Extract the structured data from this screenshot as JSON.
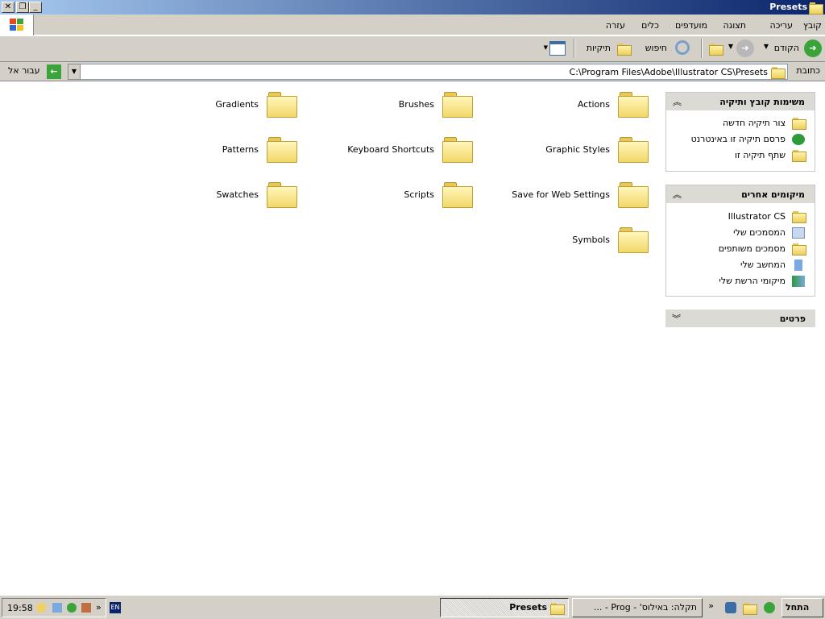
{
  "window": {
    "title": "Presets"
  },
  "menu": [
    "קובץ",
    "עריכה",
    "תצוגה",
    "מועדפים",
    "כלים",
    "עזרה"
  ],
  "toolbar": {
    "back": "הקודם",
    "search": "חיפוש",
    "folders": "תיקיות"
  },
  "address": {
    "label": "כתובת",
    "value": "C:\\Program Files\\Adobe\\Illustrator CS\\Presets",
    "go": "עבור אל"
  },
  "tasks": {
    "title": "משימות קובץ ותיקיה",
    "items": [
      "צור תיקיה חדשה",
      "פרסם תיקיה זו באינטרנט",
      "שתף תיקיה זו"
    ]
  },
  "places": {
    "title": "מיקומים אחרים",
    "items": [
      "Illustrator CS",
      "המסמכים שלי",
      "מסמכים משותפים",
      "המחשב שלי",
      "מיקומי הרשת שלי"
    ]
  },
  "details": {
    "title": "פרטים"
  },
  "folders": [
    "Actions",
    "Brushes",
    "Gradients",
    "Graphic Styles",
    "Keyboard Shortcuts",
    "Patterns",
    "Save for Web Settings",
    "Scripts",
    "Swatches",
    "Symbols"
  ],
  "taskbar": {
    "start": "התחל",
    "tasks": [
      "תקלה: באילוס' - Prog - ...",
      "Presets"
    ],
    "lang": "EN",
    "clock": "19:58",
    "more": "»"
  }
}
